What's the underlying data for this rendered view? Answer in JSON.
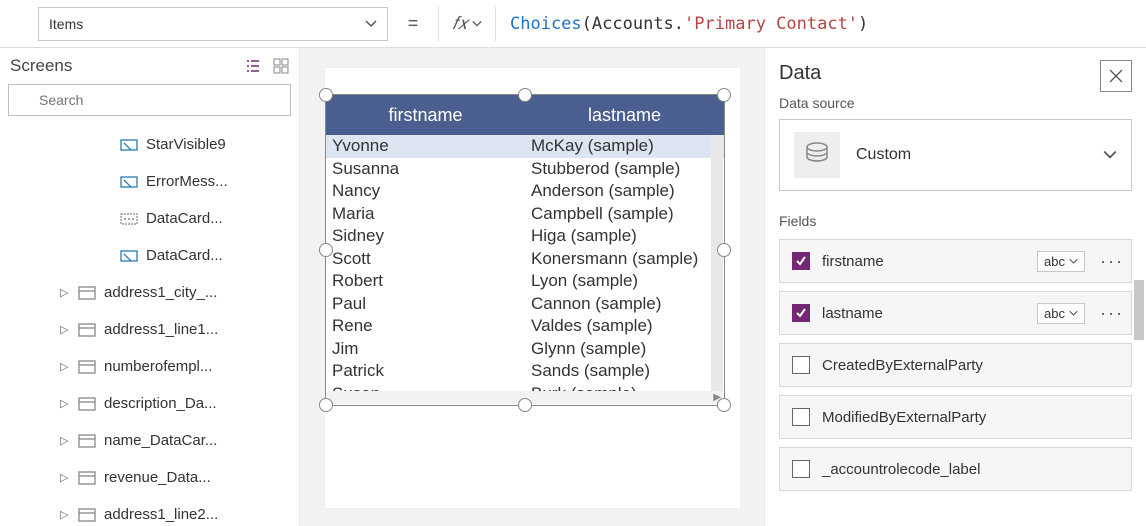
{
  "property_selector": {
    "value": "Items"
  },
  "formula": {
    "func": "Choices",
    "open": "( ",
    "ident": "Accounts",
    "dot": ".",
    "string": "'Primary Contact'",
    "close": " )"
  },
  "tree": {
    "title": "Screens",
    "search_placeholder": "Search",
    "items_level2": [
      {
        "label": "StarVisible9",
        "icon": "input"
      },
      {
        "label": "ErrorMess...",
        "icon": "input"
      },
      {
        "label": "DataCard...",
        "icon": "text"
      },
      {
        "label": "DataCard...",
        "icon": "input"
      }
    ],
    "items_level1": [
      {
        "label": "address1_city_..."
      },
      {
        "label": "address1_line1..."
      },
      {
        "label": "numberofempl..."
      },
      {
        "label": "description_Da..."
      },
      {
        "label": "name_DataCar..."
      },
      {
        "label": "revenue_Data..."
      },
      {
        "label": "address1_line2..."
      }
    ]
  },
  "table": {
    "headers": [
      "firstname",
      "lastname"
    ],
    "rows": [
      [
        "Yvonne",
        "McKay (sample)"
      ],
      [
        "Susanna",
        "Stubberod (sample)"
      ],
      [
        "Nancy",
        "Anderson (sample)"
      ],
      [
        "Maria",
        "Campbell (sample)"
      ],
      [
        "Sidney",
        "Higa (sample)"
      ],
      [
        "Scott",
        "Konersmann (sample)"
      ],
      [
        "Robert",
        "Lyon (sample)"
      ],
      [
        "Paul",
        "Cannon (sample)"
      ],
      [
        "Rene",
        "Valdes (sample)"
      ],
      [
        "Jim",
        "Glynn (sample)"
      ],
      [
        "Patrick",
        "Sands (sample)"
      ],
      [
        "Susan",
        "Burk (sample)"
      ]
    ]
  },
  "data_panel": {
    "title": "Data",
    "ds_label": "Data source",
    "ds_name": "Custom",
    "fields_label": "Fields",
    "fields": [
      {
        "name": "firstname",
        "checked": true,
        "type": "abc"
      },
      {
        "name": "lastname",
        "checked": true,
        "type": "abc"
      },
      {
        "name": "CreatedByExternalParty",
        "checked": false,
        "type": null
      },
      {
        "name": "ModifiedByExternalParty",
        "checked": false,
        "type": null
      },
      {
        "name": "_accountrolecode_label",
        "checked": false,
        "type": null
      }
    ]
  }
}
